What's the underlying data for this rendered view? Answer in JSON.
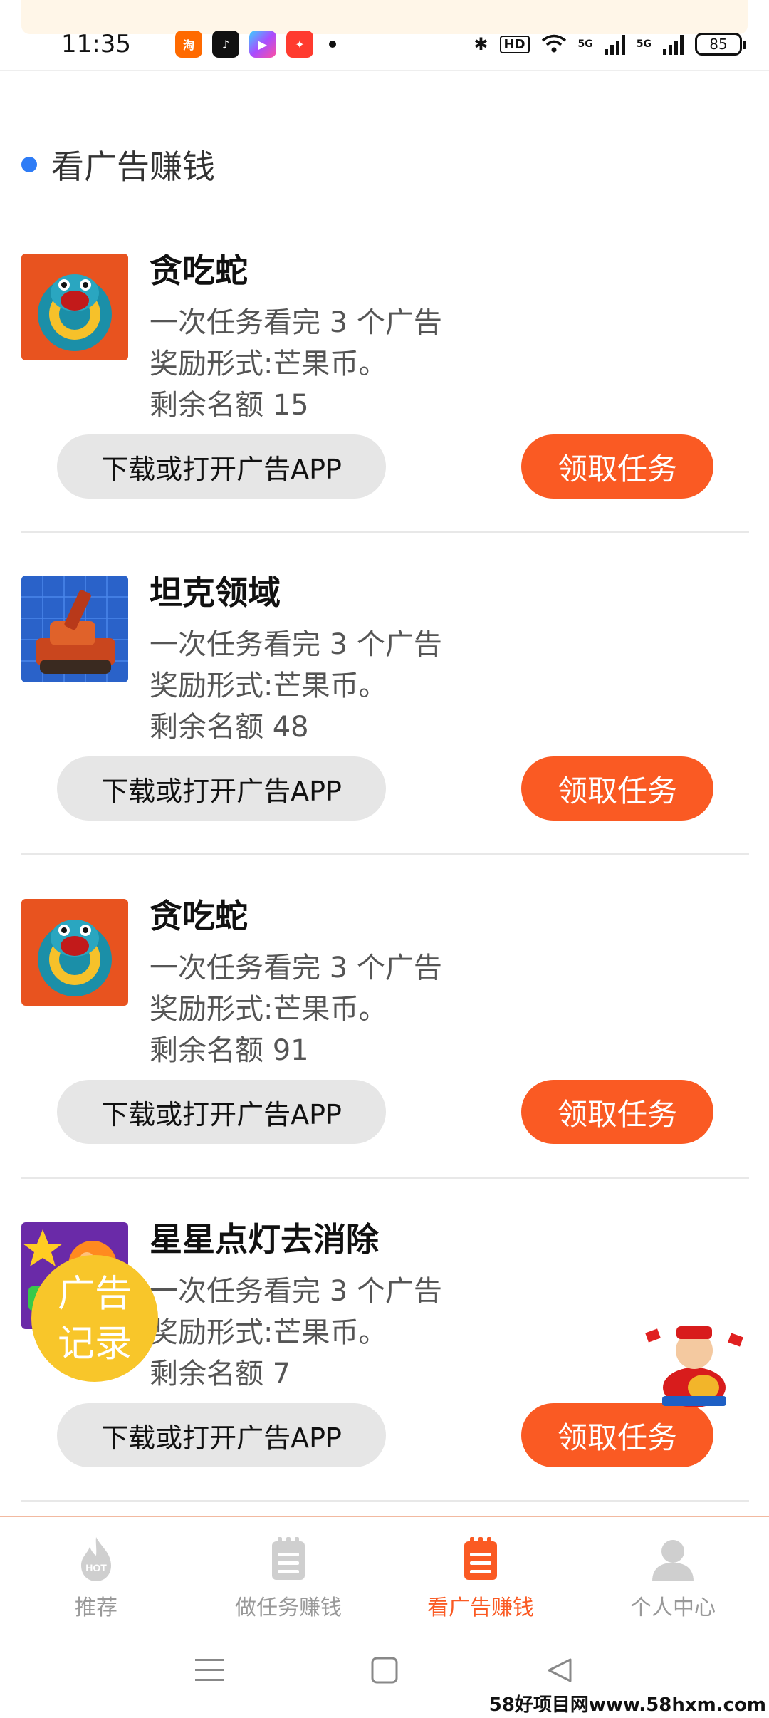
{
  "status_bar": {
    "time": "11:35",
    "battery": "85",
    "network": "5G",
    "hd_label": "HD"
  },
  "section": {
    "title": "看广告赚钱"
  },
  "tasks": [
    {
      "title": "贪吃蛇",
      "line1": "一次任务看完 3 个广告",
      "line2": "奖励形式:芒果币。",
      "line3": "剩余名额 15",
      "download_label": "下载或打开广告APP",
      "claim_label": "领取任务",
      "icon": "snake-game-icon"
    },
    {
      "title": "坦克领域",
      "line1": "一次任务看完 3 个广告",
      "line2": "奖励形式:芒果币。",
      "line3": "剩余名额 48",
      "download_label": "下载或打开广告APP",
      "claim_label": "领取任务",
      "icon": "tank-game-icon"
    },
    {
      "title": "贪吃蛇",
      "line1": "一次任务看完 3 个广告",
      "line2": "奖励形式:芒果币。",
      "line3": "剩余名额 91",
      "download_label": "下载或打开广告APP",
      "claim_label": "领取任务",
      "icon": "snake-game-icon"
    },
    {
      "title": "星星点灯去消除",
      "line1": "一次任务看完 3 个广告",
      "line2": "奖励形式:芒果币。",
      "line3": "剩余名额 7",
      "download_label": "下载或打开广告APP",
      "claim_label": "领取任务",
      "icon": "match-game-icon"
    }
  ],
  "float_badge": {
    "line1": "广告",
    "line2": "记录"
  },
  "bottom_nav": [
    {
      "label": "推荐",
      "icon": "hot-flame-icon",
      "active": false
    },
    {
      "label": "做任务赚钱",
      "icon": "clipboard-icon",
      "active": false
    },
    {
      "label": "看广告赚钱",
      "icon": "clipboard-list-icon",
      "active": true
    },
    {
      "label": "个人中心",
      "icon": "user-icon",
      "active": false
    }
  ],
  "colors": {
    "accent": "#fa5a23",
    "section_dot": "#2e7cf6",
    "badge": "#f8c62a"
  },
  "watermark": "58好项目网www.58hxm.com"
}
